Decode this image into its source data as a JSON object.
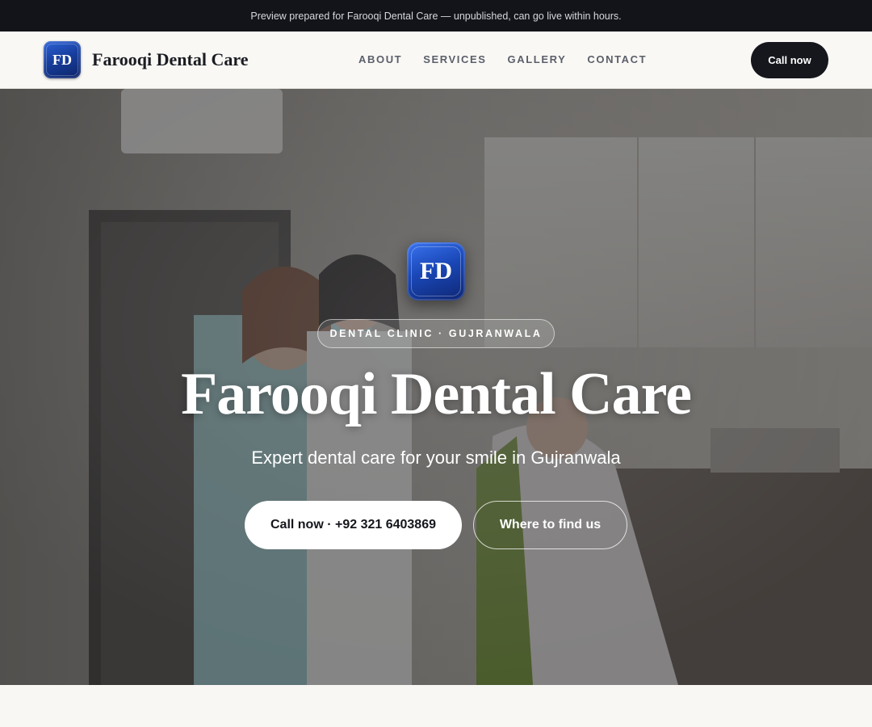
{
  "banner": {
    "text": "Preview prepared for Farooqi Dental Care — unpublished, can go live within hours."
  },
  "header": {
    "logo_text": "FD",
    "brand": "Farooqi Dental Care",
    "nav": [
      "ABOUT",
      "SERVICES",
      "GALLERY",
      "CONTACT"
    ],
    "cta": "Call now"
  },
  "hero": {
    "logo_text": "FD",
    "eyebrow": "DENTAL CLINIC · GUJRANWALA",
    "title": "Farooqi Dental Care",
    "subtitle": "Expert dental care for your smile in Gujranwala",
    "primary_button": "Call now · +92 321 6403869",
    "secondary_button": "Where to find us"
  },
  "colors": {
    "dark": "#15171c",
    "brand_blue": "#1a48b8",
    "page_bg": "#f8f7f4"
  }
}
